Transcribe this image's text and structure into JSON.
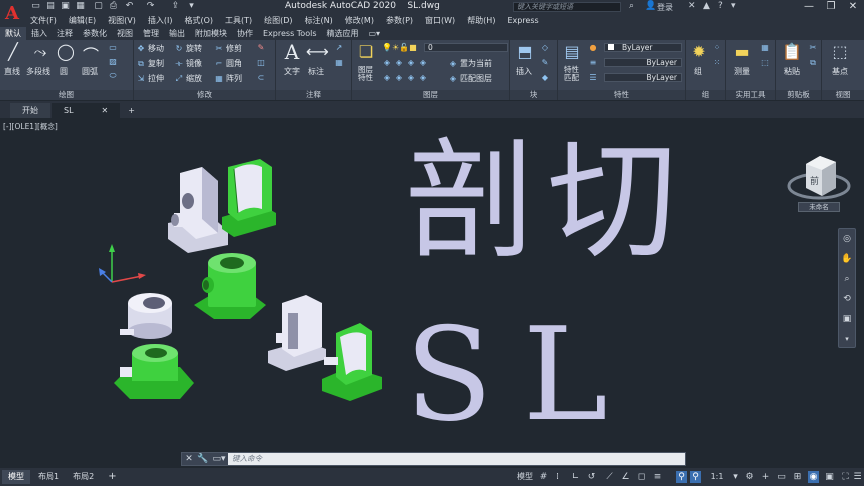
{
  "title_bar": {
    "app_title": "Autodesk AutoCAD 2020",
    "file_name": "SL.dwg",
    "search_placeholder": "键入关键字或短语",
    "login_label": "登录"
  },
  "menu": [
    "文件(F)",
    "编辑(E)",
    "视图(V)",
    "插入(I)",
    "格式(O)",
    "工具(T)",
    "绘图(D)",
    "标注(N)",
    "修改(M)",
    "参数(P)",
    "窗口(W)",
    "帮助(H)",
    "Express"
  ],
  "ribbon_tabs": {
    "items": [
      "默认",
      "插入",
      "注释",
      "参数化",
      "视图",
      "管理",
      "输出",
      "附加模块",
      "协作",
      "Express Tools",
      "精选应用"
    ],
    "active_index": 0
  },
  "ribbon": {
    "draw": {
      "label": "绘图",
      "line": "直线",
      "polyline": "多段线",
      "circle": "圆",
      "arc": "圆弧"
    },
    "modify": {
      "label": "修改",
      "move": "移动",
      "rotate": "旋转",
      "trim": "修剪",
      "copy": "复制",
      "mirror": "镜像",
      "fillet": "圆角",
      "stretch": "拉伸",
      "scale": "缩放",
      "array": "阵列"
    },
    "annotation": {
      "label": "注释",
      "text": "文字",
      "dimension": "标注"
    },
    "layers": {
      "label": "图层",
      "layer_props": "图层特性",
      "current_layer": "0",
      "make_current": "置为当前",
      "match_layer": "匹配图层"
    },
    "block": {
      "label": "块",
      "insert": "插入"
    },
    "properties": {
      "label": "特性",
      "match": "特性匹配",
      "color": "ByLayer",
      "linetype": "ByLayer",
      "lineweight": "ByLayer"
    },
    "groups": {
      "label": "组",
      "group": "组"
    },
    "utilities": {
      "label": "实用工具",
      "measure": "测量"
    },
    "clipboard": {
      "label": "剪贴板",
      "paste": "粘贴"
    },
    "view": {
      "label": "视图",
      "base": "基点"
    }
  },
  "doc_tabs": [
    "开始",
    "SL"
  ],
  "viewport": {
    "label": "[-][OLE1][概念]",
    "heading_zh": "剖切",
    "heading_en": "SL",
    "viewcube_face": "前",
    "viewcube_wcs": "未命名"
  },
  "command_line": {
    "placeholder": "键入命令"
  },
  "status_bar": {
    "layout_tabs": [
      "模型",
      "布局1",
      "布局2"
    ],
    "model_label": "模型",
    "scale": "1:1"
  },
  "colors": {
    "accent_red": "#e0312f",
    "part_green": "#2fd12f",
    "part_white": "#e8e8f4",
    "text_lavender": "#c7c7e6"
  }
}
